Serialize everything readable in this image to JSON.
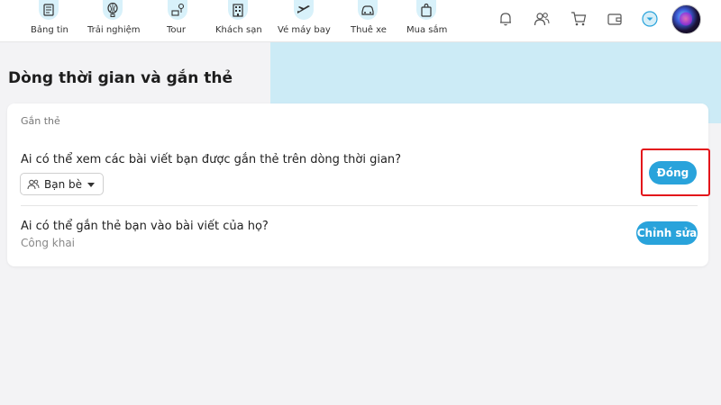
{
  "nav": {
    "items": [
      {
        "label": "Bảng tin",
        "icon": "news-icon"
      },
      {
        "label": "Trải nghiệm",
        "icon": "balloon-icon"
      },
      {
        "label": "Tour",
        "icon": "tour-icon"
      },
      {
        "label": "Khách sạn",
        "icon": "hotel-icon"
      },
      {
        "label": "Vé máy bay",
        "icon": "plane-icon"
      },
      {
        "label": "Thuê xe",
        "icon": "car-icon"
      },
      {
        "label": "Mua sắm",
        "icon": "shopping-bag-icon"
      }
    ],
    "right_icons": [
      "bell-icon",
      "friends-icon",
      "cart-icon",
      "wallet-icon",
      "chevron-down-circle-icon"
    ]
  },
  "page": {
    "title": "Dòng thời gian và gắn thẻ"
  },
  "card": {
    "title": "Gắn thẻ",
    "question1": "Ai có thể xem các bài viết bạn được gắn thẻ trên dòng thời gian?",
    "dropdown_value": "Bạn bè",
    "button1_label": "Đóng",
    "question2": "Ai có thể gắn thẻ bạn vào bài viết của họ?",
    "question2_value": "Công khai",
    "button2_label": "Chỉnh sửa"
  },
  "colors": {
    "accent": "#29a3db",
    "highlight": "#e3141b",
    "banner": "#b3e6f7"
  }
}
